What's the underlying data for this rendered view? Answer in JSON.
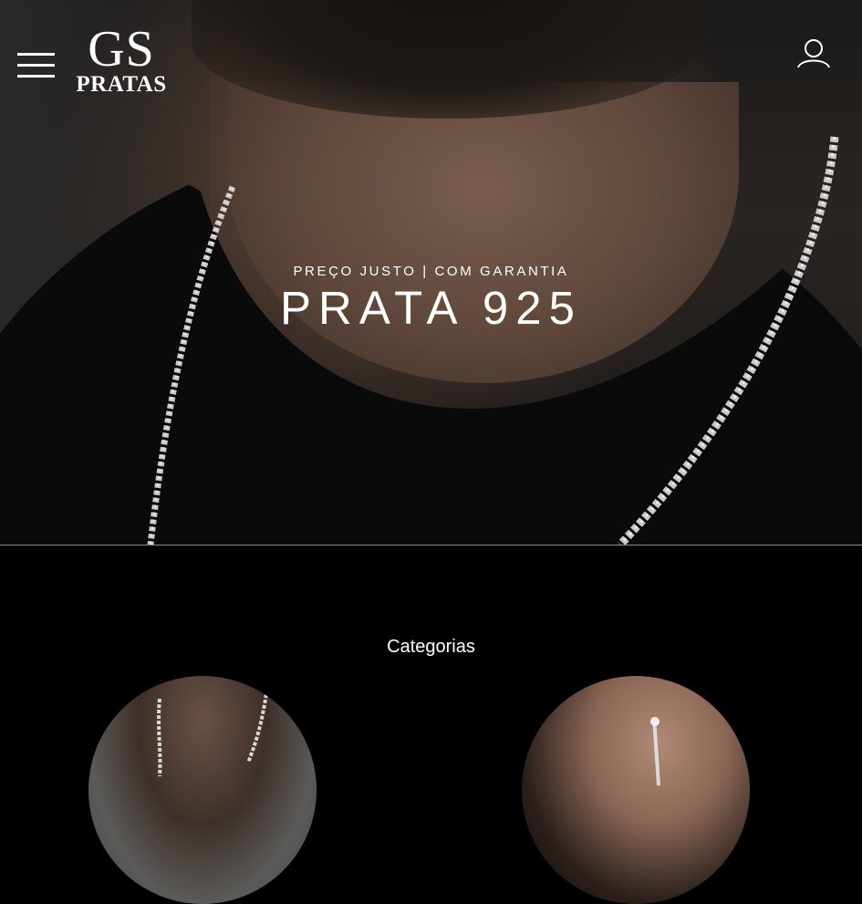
{
  "header": {
    "logo_top": "GS",
    "logo_bottom": "PRATAS",
    "icons": {
      "menu": "hamburger-menu-icon",
      "account": "user-account-icon"
    }
  },
  "hero": {
    "tagline": "PREÇO JUSTO | COM GARANTIA",
    "headline": "PRATA 925"
  },
  "categories": {
    "title": "Categorias",
    "items": [
      {
        "image": "man-wearing-rope-chain"
      },
      {
        "image": "woman-wearing-earring"
      }
    ]
  },
  "colors": {
    "background": "#000000",
    "text": "#ffffff",
    "divider": "#8a8a8a"
  }
}
